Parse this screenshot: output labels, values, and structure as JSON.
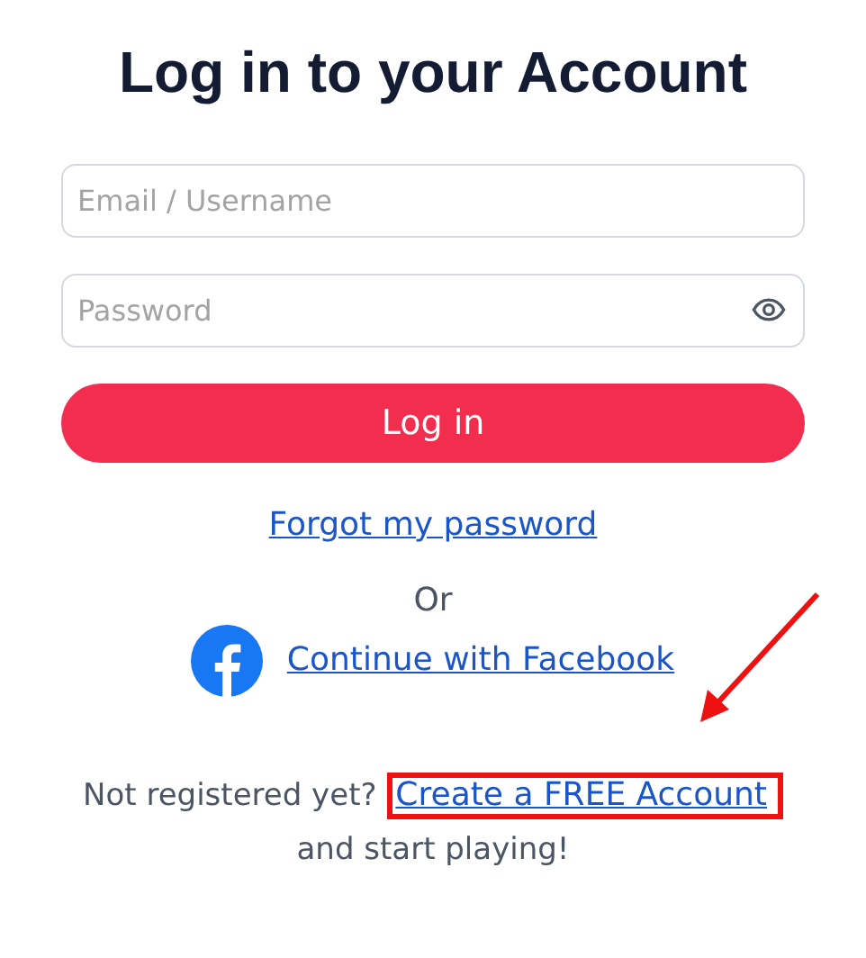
{
  "title": "Log in to your Account",
  "fields": [
    {
      "placeholder": "Email / Username",
      "kind": "text"
    },
    {
      "placeholder": "Password",
      "kind": "password"
    }
  ],
  "login_button": "Log in",
  "forgot_link": "Forgot my password",
  "separator": "Or",
  "facebook_link": "Continue with Facebook",
  "signup": {
    "prefix": "Not registered yet?",
    "link": "Create a FREE Account",
    "suffix": "and start playing!",
    "highlighted": true
  },
  "pointer_arrow": true
}
